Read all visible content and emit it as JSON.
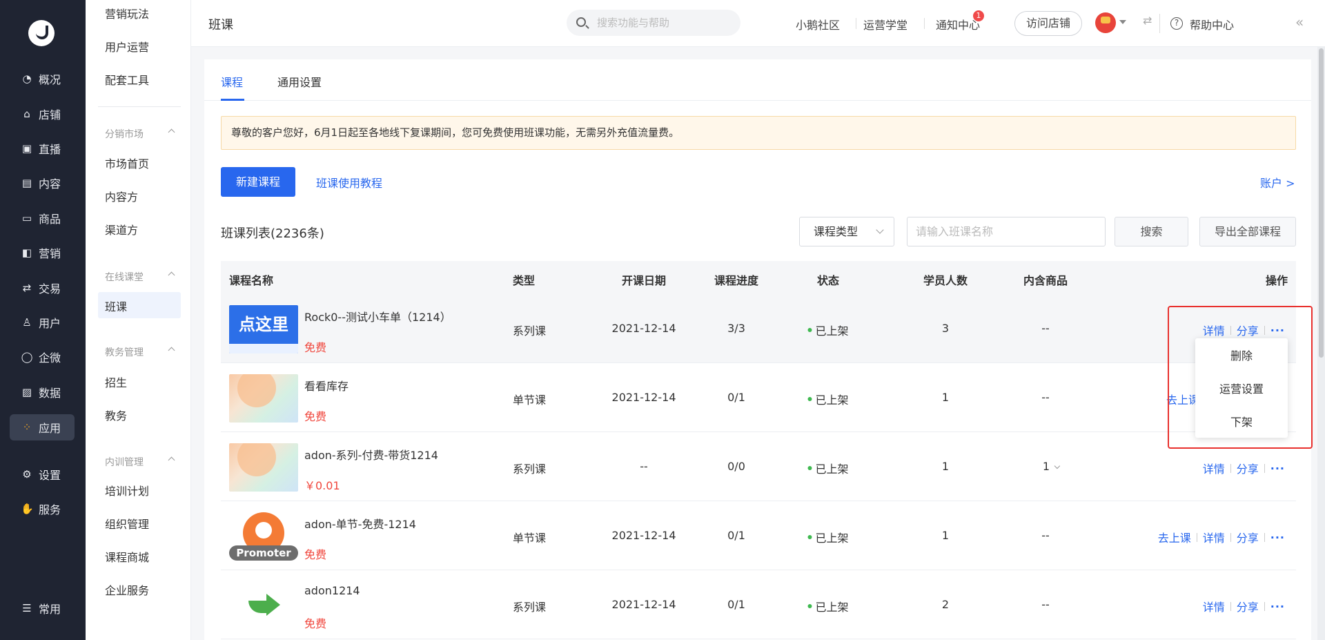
{
  "nav": {
    "items": [
      {
        "label": "概况",
        "icon": "pie-chart-icon"
      },
      {
        "label": "店铺",
        "icon": "store-icon"
      },
      {
        "label": "直播",
        "icon": "live-icon"
      },
      {
        "label": "内容",
        "icon": "document-icon"
      },
      {
        "label": "商品",
        "icon": "box-icon"
      },
      {
        "label": "营销",
        "icon": "megaphone-icon"
      },
      {
        "label": "交易",
        "icon": "exchange-icon"
      },
      {
        "label": "用户",
        "icon": "user-icon"
      },
      {
        "label": "企微",
        "icon": "chat-icon"
      },
      {
        "label": "数据",
        "icon": "chart-icon"
      },
      {
        "label": "应用",
        "icon": "apps-icon"
      },
      {
        "label": "设置",
        "icon": "gear-icon"
      },
      {
        "label": "服务",
        "icon": "service-icon"
      },
      {
        "label": "常用",
        "icon": "list-icon"
      }
    ]
  },
  "sub": {
    "top_links": [
      "营销玩法",
      "用户运营",
      "配套工具"
    ],
    "groups": [
      {
        "title": "分销市场",
        "links": [
          "市场首页",
          "内容方",
          "渠道方"
        ]
      },
      {
        "title": "在线课堂",
        "links": [
          "班课"
        ]
      },
      {
        "title": "教务管理",
        "links": [
          "招生",
          "教务"
        ]
      },
      {
        "title": "内训管理",
        "links": [
          "培训计划",
          "组织管理",
          "课程商城",
          "企业服务"
        ]
      }
    ]
  },
  "header": {
    "title": "班课",
    "search_placeholder": "搜索功能与帮助",
    "links": [
      "小鹅社区",
      "运营学堂",
      "通知中心"
    ],
    "notify_badge": "1",
    "visit_store": "访问店铺",
    "help": "帮助中心"
  },
  "tabs": [
    "课程",
    "通用设置"
  ],
  "notice": "尊敬的客户您好，6月1日起至各地线下复课期间，您可免费使用班课功能，无需另外充值流量费。",
  "actions": {
    "new_course": "新建课程",
    "tutorial": "班课使用教程",
    "account": "账户 >"
  },
  "list": {
    "title": "班课列表(2236条)",
    "type_select": "课程类型",
    "keyword_placeholder": "请输入班课名称",
    "search_btn": "搜索",
    "export_btn": "导出全部课程"
  },
  "table": {
    "headers": [
      "课程名称",
      "类型",
      "开课日期",
      "课程进度",
      "状态",
      "学员人数",
      "内含商品",
      "操作"
    ],
    "rows": [
      {
        "name": "Rock0--测试小车单（1214）",
        "price": "免费",
        "thumb_text": "点这里",
        "type": "系列课",
        "date": "2021-12-14",
        "progress": "3/3",
        "status": "已上架",
        "students": "3",
        "goods": "--",
        "ops": [
          "详情",
          "分享",
          "···"
        ]
      },
      {
        "name": "看看库存",
        "price": "免费",
        "type": "单节课",
        "date": "2021-12-14",
        "progress": "0/1",
        "status": "已上架",
        "students": "1",
        "goods": "--",
        "ops": [
          "去上课"
        ]
      },
      {
        "name": "adon-系列-付费-带货1214",
        "price": "￥0.01",
        "type": "系列课",
        "date": "--",
        "progress": "0/0",
        "status": "已上架",
        "students": "1",
        "goods": "1",
        "ops": [
          "详情",
          "分享",
          "···"
        ]
      },
      {
        "name": "adon-单节-免费-1214",
        "price": "免费",
        "thumb_text": "Promoter",
        "type": "单节课",
        "date": "2021-12-14",
        "progress": "0/1",
        "status": "已上架",
        "students": "1",
        "goods": "--",
        "ops": [
          "去上课",
          "详情",
          "分享",
          "···"
        ]
      },
      {
        "name": "adon1214",
        "price": "免费",
        "type": "系列课",
        "date": "2021-12-14",
        "progress": "0/1",
        "status": "已上架",
        "students": "2",
        "goods": "--",
        "ops": [
          "详情",
          "分享",
          "···"
        ]
      }
    ]
  },
  "popup_menu": [
    "删除",
    "运营设置",
    "下架"
  ]
}
